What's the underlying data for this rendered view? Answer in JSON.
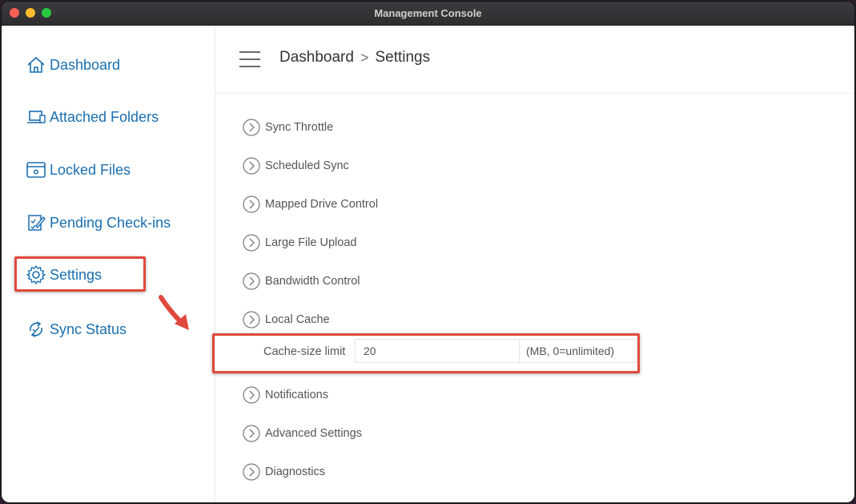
{
  "window": {
    "title": "Management Console"
  },
  "sidebar": {
    "items": [
      {
        "label": "Dashboard",
        "icon": "home-icon"
      },
      {
        "label": "Attached Folders",
        "icon": "laptop-icon"
      },
      {
        "label": "Locked Files",
        "icon": "locked-file-icon"
      },
      {
        "label": "Pending Check-ins",
        "icon": "checklist-icon"
      },
      {
        "label": "Settings",
        "icon": "gear-icon",
        "highlighted": true
      },
      {
        "label": "Sync Status",
        "icon": "sync-icon"
      }
    ]
  },
  "header": {
    "breadcrumb": [
      "Dashboard",
      "Settings"
    ],
    "separator": ">"
  },
  "settings": {
    "sections": [
      "Sync Throttle",
      "Scheduled Sync",
      "Mapped Drive Control",
      "Large File Upload",
      "Bandwidth Control",
      "Local Cache",
      "Notifications",
      "Advanced Settings",
      "Diagnostics"
    ],
    "cache": {
      "label": "Cache-size limit",
      "value": "20",
      "unit": "(MB, 0=unlimited)"
    }
  },
  "colors": {
    "accent": "#1a6fb0",
    "highlight": "#e0493c",
    "titlebar": "#2e2d30"
  }
}
